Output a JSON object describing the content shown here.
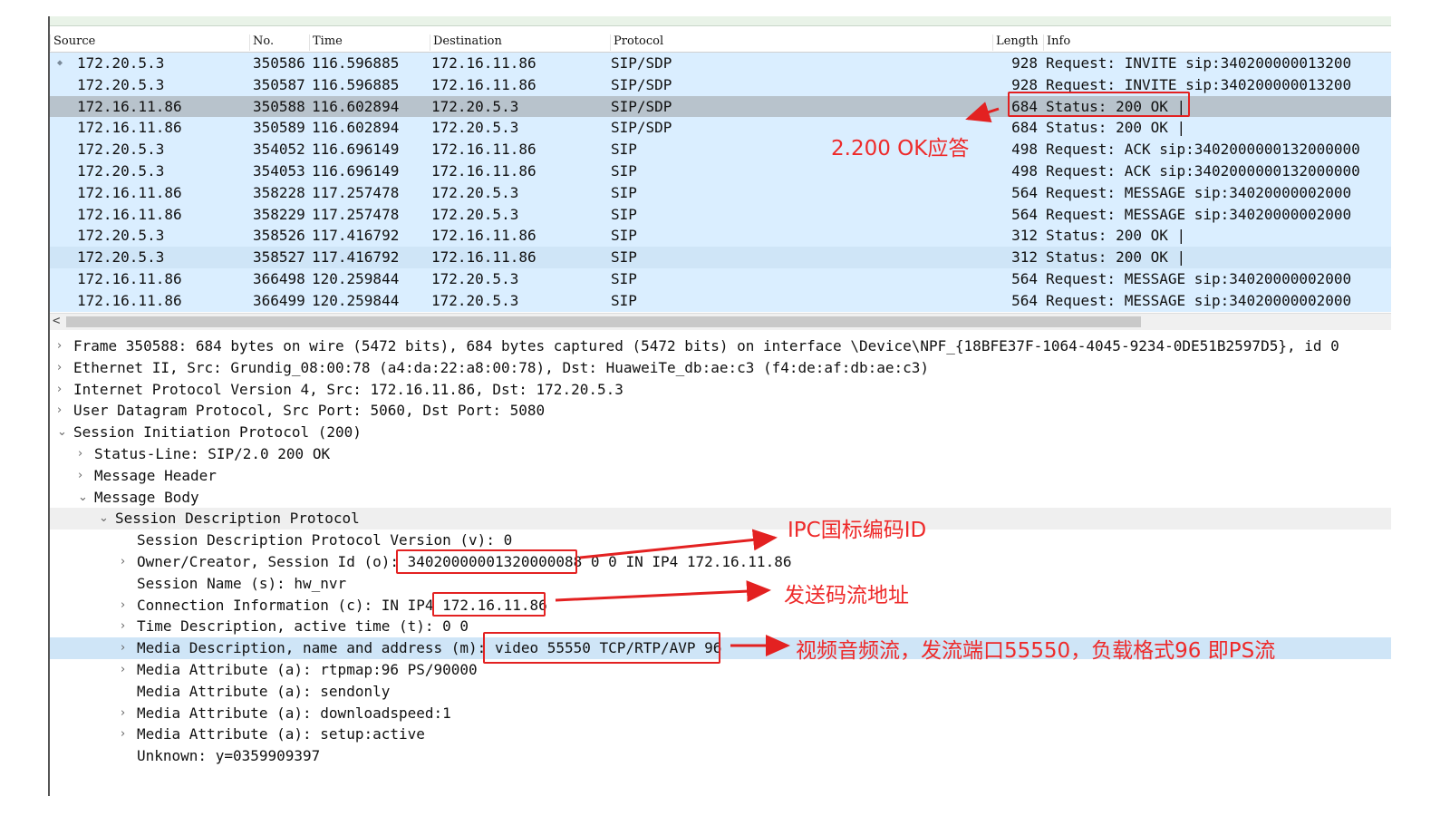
{
  "columns": {
    "source": "Source",
    "no": "No.",
    "time": "Time",
    "destination": "Destination",
    "protocol": "Protocol",
    "length": "Length",
    "info": "Info"
  },
  "packets": [
    {
      "source": "172.20.5.3",
      "no": "350586",
      "time": "116.596885",
      "destination": "172.16.11.86",
      "protocol": "SIP/SDP",
      "length": "928",
      "info": "Request: INVITE sip:340200000013200"
    },
    {
      "source": "172.20.5.3",
      "no": "350587",
      "time": "116.596885",
      "destination": "172.16.11.86",
      "protocol": "SIP/SDP",
      "length": "928",
      "info": "Request: INVITE sip:340200000013200"
    },
    {
      "source": "172.16.11.86",
      "no": "350588",
      "time": "116.602894",
      "destination": "172.20.5.3",
      "protocol": "SIP/SDP",
      "length": "684",
      "info": "Status: 200 OK |"
    },
    {
      "source": "172.16.11.86",
      "no": "350589",
      "time": "116.602894",
      "destination": "172.20.5.3",
      "protocol": "SIP/SDP",
      "length": "684",
      "info": "Status: 200 OK |"
    },
    {
      "source": "172.20.5.3",
      "no": "354052",
      "time": "116.696149",
      "destination": "172.16.11.86",
      "protocol": "SIP",
      "length": "498",
      "info": "Request: ACK sip:3402000000132000000"
    },
    {
      "source": "172.20.5.3",
      "no": "354053",
      "time": "116.696149",
      "destination": "172.16.11.86",
      "protocol": "SIP",
      "length": "498",
      "info": "Request: ACK sip:3402000000132000000"
    },
    {
      "source": "172.16.11.86",
      "no": "358228",
      "time": "117.257478",
      "destination": "172.20.5.3",
      "protocol": "SIP",
      "length": "564",
      "info": "Request: MESSAGE sip:34020000002000"
    },
    {
      "source": "172.16.11.86",
      "no": "358229",
      "time": "117.257478",
      "destination": "172.20.5.3",
      "protocol": "SIP",
      "length": "564",
      "info": "Request: MESSAGE sip:34020000002000"
    },
    {
      "source": "172.20.5.3",
      "no": "358526",
      "time": "117.416792",
      "destination": "172.16.11.86",
      "protocol": "SIP",
      "length": "312",
      "info": "Status: 200 OK |"
    },
    {
      "source": "172.20.5.3",
      "no": "358527",
      "time": "117.416792",
      "destination": "172.16.11.86",
      "protocol": "SIP",
      "length": "312",
      "info": "Status: 200 OK |"
    },
    {
      "source": "172.16.11.86",
      "no": "366498",
      "time": "120.259844",
      "destination": "172.20.5.3",
      "protocol": "SIP",
      "length": "564",
      "info": "Request: MESSAGE sip:34020000002000"
    },
    {
      "source": "172.16.11.86",
      "no": "366499",
      "time": "120.259844",
      "destination": "172.20.5.3",
      "protocol": "SIP",
      "length": "564",
      "info": "Request: MESSAGE sip:34020000002000"
    }
  ],
  "details": [
    {
      "text": "Frame 350588: 684 bytes on wire (5472 bits), 684 bytes captured (5472 bits) on interface \\Device\\NPF_{18BFE37F-1064-4045-9234-0DE51B2597D5}, id 0",
      "level": 0,
      "expander": "›"
    },
    {
      "text": "Ethernet II, Src: Grundig_08:00:78 (a4:da:22:a8:00:78), Dst: HuaweiTe_db:ae:c3 (f4:de:af:db:ae:c3)",
      "level": 0,
      "expander": "›"
    },
    {
      "text": "Internet Protocol Version 4, Src: 172.16.11.86, Dst: 172.20.5.3",
      "level": 0,
      "expander": "›"
    },
    {
      "text": "User Datagram Protocol, Src Port: 5060, Dst Port: 5080",
      "level": 0,
      "expander": "›"
    },
    {
      "text": "Session Initiation Protocol (200)",
      "level": 0,
      "expander": "⌄"
    },
    {
      "text": "Status-Line: SIP/2.0 200 OK",
      "level": 1,
      "expander": "›"
    },
    {
      "text": "Message Header",
      "level": 1,
      "expander": "›"
    },
    {
      "text": "Message Body",
      "level": 1,
      "expander": "⌄"
    },
    {
      "text": "Session Description Protocol",
      "level": 2,
      "expander": "⌄"
    },
    {
      "text": "Session Description Protocol Version (v): 0",
      "level": 3,
      "expander": ""
    },
    {
      "text": "Owner/Creator, Session Id (o): 34020000001320000088 0 0 IN IP4 172.16.11.86",
      "level": 3,
      "expander": "›"
    },
    {
      "text": "Session Name (s): hw_nvr",
      "level": 3,
      "expander": ""
    },
    {
      "text": "Connection Information (c): IN IP4 172.16.11.86",
      "level": 3,
      "expander": "›"
    },
    {
      "text": "Time Description, active time (t): 0 0",
      "level": 3,
      "expander": "›"
    },
    {
      "text": "Media Description, name and address (m): video 55550 TCP/RTP/AVP 96",
      "level": 3,
      "expander": "›"
    },
    {
      "text": "Media Attribute (a): rtpmap:96 PS/90000",
      "level": 3,
      "expander": "›"
    },
    {
      "text": "Media Attribute (a): sendonly",
      "level": 3,
      "expander": ""
    },
    {
      "text": "Media Attribute (a): downloadspeed:1",
      "level": 3,
      "expander": "›"
    },
    {
      "text": "Media Attribute (a): setup:active",
      "level": 3,
      "expander": "›"
    },
    {
      "text": "Unknown: y=0359909397",
      "level": 3,
      "expander": ""
    }
  ],
  "annotations": {
    "ok_reply": "2.200 OK应答",
    "ipc_id": "IPC国标编码ID",
    "stream_addr": "发送码流地址",
    "media_stream": "视频音频流，发流端口55550，负载格式96 即PS流"
  },
  "colors": {
    "accent": "#e32121",
    "row_bg": "#daeeff",
    "selected_bg": "#b8c3cc"
  }
}
